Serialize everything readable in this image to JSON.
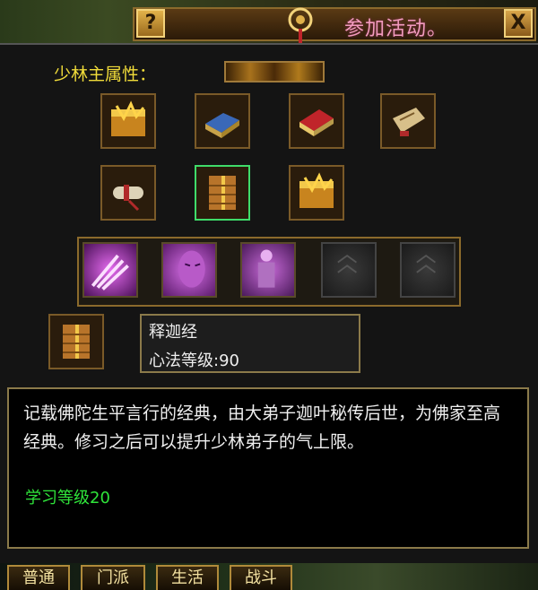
{
  "window": {
    "title_text": "参加活动。",
    "help_label": "?",
    "close_label": "X"
  },
  "attribute": {
    "label": "少林主属性："
  },
  "books": [
    {
      "icon": "golden-book-icon"
    },
    {
      "icon": "blue-book-icon"
    },
    {
      "icon": "red-book-icon"
    },
    {
      "icon": "map-scroll-icon"
    },
    {
      "icon": "rolled-scroll-icon"
    },
    {
      "icon": "sutra-bundle-icon"
    },
    {
      "icon": "golden-book-icon"
    }
  ],
  "skills": [
    {
      "icon": "clawed-hand-icon",
      "state": "filled"
    },
    {
      "icon": "meditating-face-icon",
      "state": "filled"
    },
    {
      "icon": "standing-monk-icon",
      "state": "filled"
    },
    {
      "icon": "empty-slot-icon",
      "state": "empty"
    },
    {
      "icon": "empty-slot-icon",
      "state": "empty"
    }
  ],
  "selected_item": {
    "icon": "sutra-bundle-icon",
    "name": "释迦经",
    "level_text": "心法等级:90"
  },
  "description": {
    "text": "记载佛陀生平言行的经典，由大弟子迦叶秘传后世，为佛家至高经典。修习之后可以提升少林弟子的气上限。",
    "requirement": "学习等级20"
  },
  "tabs": [
    {
      "label": "普通"
    },
    {
      "label": "门派"
    },
    {
      "label": "生活"
    },
    {
      "label": "战斗"
    }
  ],
  "colors": {
    "attribute_label": "#f1dc3a",
    "requirement_text": "#2fe43a",
    "selected_border": "#3fdc6a",
    "title_text": "#f39bbf"
  }
}
